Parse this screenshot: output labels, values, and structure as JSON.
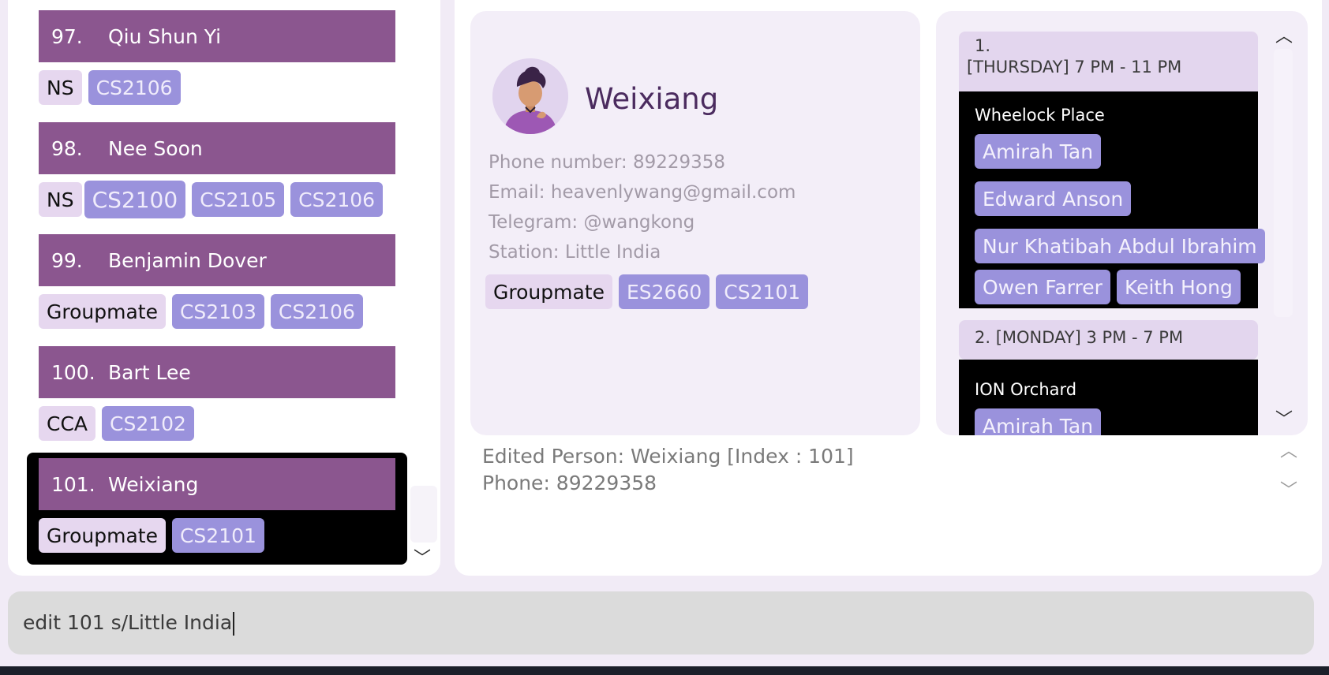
{
  "person_list": [
    {
      "index": "97.",
      "name": "Qiu Shun Yi",
      "tags": [
        {
          "label": "NS",
          "kind": "role"
        },
        {
          "label": "CS2106",
          "kind": "mod"
        }
      ]
    },
    {
      "index": "98.",
      "name": "Nee Soon",
      "tags": [
        {
          "label": "NS",
          "kind": "role"
        },
        {
          "label": "CS2100",
          "kind": "mod"
        },
        {
          "label": "CS2105",
          "kind": "mod"
        },
        {
          "label": "CS2106",
          "kind": "mod"
        }
      ]
    },
    {
      "index": "99.",
      "name": "Benjamin Dover",
      "tags": [
        {
          "label": "Groupmate",
          "kind": "role"
        },
        {
          "label": "CS2103",
          "kind": "mod"
        },
        {
          "label": "CS2106",
          "kind": "mod"
        }
      ]
    },
    {
      "index": "100.",
      "name": "Bart Lee",
      "tags": [
        {
          "label": "CCA",
          "kind": "role"
        },
        {
          "label": "CS2102",
          "kind": "mod"
        }
      ]
    },
    {
      "index": "101.",
      "name": "Weixiang",
      "tags": [
        {
          "label": "Groupmate",
          "kind": "role"
        },
        {
          "label": "CS2101",
          "kind": "mod"
        }
      ]
    }
  ],
  "detail": {
    "name": "Weixiang",
    "phone": "Phone number: 89229358",
    "email": "Email: heavenlywang@gmail.com",
    "telegram": "Telegram: @wangkong",
    "station": "Station: Little India",
    "tags": [
      {
        "label": "Groupmate",
        "kind": "role"
      },
      {
        "label": "ES2660",
        "kind": "mod"
      },
      {
        "label": "CS2101",
        "kind": "mod"
      }
    ]
  },
  "schedule": [
    {
      "number": "1.",
      "time": "[THURSDAY] 7 PM - 11 PM",
      "place": "Wheelock Place",
      "members": [
        "Amirah Tan",
        "Edward Anson",
        "Nur Khatibah Abdul Ibrahim",
        "Owen Farrer",
        "Keith Hong"
      ]
    },
    {
      "number": "2. [MONDAY] 3 PM - 7 PM",
      "place": "ION Orchard",
      "members": [
        "Amirah Tan"
      ]
    }
  ],
  "result": {
    "line1": "Edited Person: Weixiang [Index : 101]",
    "line2": "Phone: 89229358"
  },
  "command": {
    "value": "edit 101 s/Little India"
  },
  "icons": {
    "chevron_up": "chevron-up-icon",
    "chevron_down": "chevron-down-icon"
  },
  "colors": {
    "header_purple": "#8b568f",
    "role_tag": "#e6d7ef",
    "module_tag": "#9a92dc",
    "selected_bg": "#000000"
  }
}
